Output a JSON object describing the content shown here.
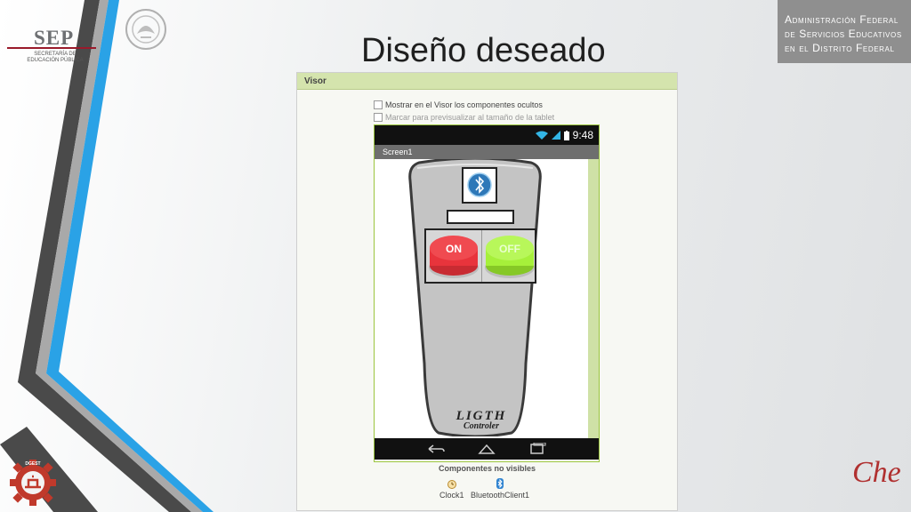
{
  "slide": {
    "title": "Diseño deseado",
    "sep_logo": {
      "name": "SEP",
      "subtitle_line1": "SECRETARÍA DE",
      "subtitle_line2": "EDUCACIÓN PÚBLICA"
    },
    "seal_text": "ESTADOS UNIDOS MEXICANOS",
    "admin_lines": [
      "Administración Federal",
      "de Servicios Educativos",
      "en el Distrito Federal"
    ],
    "stripe_colors": {
      "blue": "#2aa2e6",
      "dark": "#4a4a4a",
      "gray": "#a9a9a9"
    }
  },
  "designer": {
    "panel_title": "Visor",
    "checkbox_hidden_label": "Mostrar en el Visor los componentes ocultos",
    "checkbox_tablet_label": "Marcar para previsualizar al tamaño de la tablet",
    "status_time": "9:48",
    "screen_name": "Screen1",
    "remote_caption_line1": "LIGTH",
    "remote_caption_line2": "Controler",
    "on_label": "ON",
    "off_label": "OFF",
    "nonvisible_title": "Componentes no visibles",
    "nonvisible_components": [
      "Clock1",
      "BluetoothClient1"
    ],
    "accent_color": "#9bc53d",
    "on_color": "#e8343c",
    "off_color": "#a6f03a"
  },
  "logos": {
    "gear_text": "DGEST",
    "che_text": "Che"
  }
}
